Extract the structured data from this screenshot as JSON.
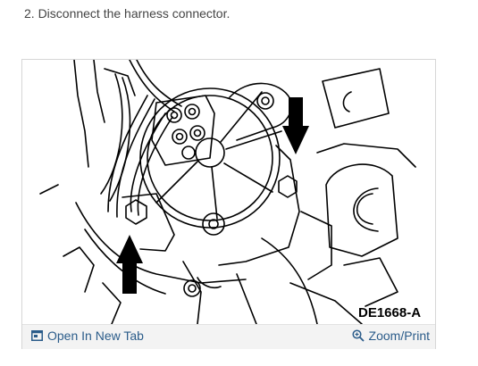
{
  "instruction": {
    "text": "2. Disconnect the harness connector."
  },
  "figure": {
    "label": "DE1668-A",
    "arrows_icon": "arrow-down-icon"
  },
  "footer": {
    "open_tab_label": "Open In New Tab",
    "open_tab_icon": "open-in-new-tab-icon",
    "zoom_label": "Zoom/Print",
    "zoom_icon": "zoom-icon"
  },
  "colors": {
    "link": "#2b5c8a",
    "text": "#444444",
    "footer_bg": "#f3f3f3",
    "border": "#d6d6d6"
  }
}
